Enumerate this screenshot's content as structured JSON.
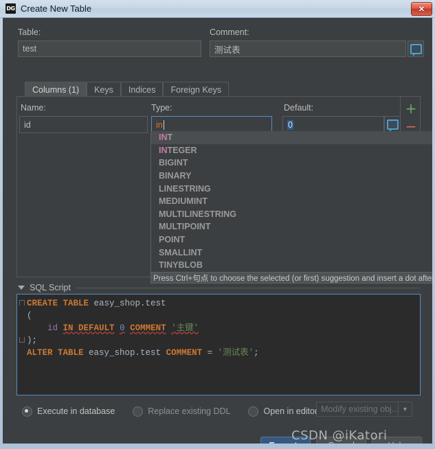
{
  "window": {
    "title": "Create New Table",
    "app_icon": "datagrip-icon",
    "app_icon_text": "DG",
    "close_label": "✕",
    "titlebar_bg": "#c6d6e6"
  },
  "form": {
    "table_label": "Table:",
    "table_label_mnemonic": "b",
    "table_value": "test",
    "comment_label": "Comment:",
    "comment_label_mnemonic": "C",
    "comment_value": "测试表",
    "comment_button_icon": "comment-bubble-icon"
  },
  "tabs": [
    {
      "label": "Columns (1)",
      "active": true
    },
    {
      "label": "Keys",
      "active": false
    },
    {
      "label": "Indices",
      "active": false
    },
    {
      "label": "Foreign Keys",
      "active": false
    }
  ],
  "columns_panel": {
    "name_label": "Name:",
    "type_label": "Type:",
    "default_label": "Default:",
    "row": {
      "name": "id",
      "type": "in",
      "default": "0",
      "comment_button_icon": "comment-bubble-icon"
    },
    "add_label": "+",
    "remove_label": "−",
    "add_color": "#69ac67",
    "remove_color": "#d06b5c"
  },
  "autocomplete": {
    "prefix": "IN",
    "items": [
      {
        "text": "INT",
        "match": "IN",
        "selected": true
      },
      {
        "text": "INTEGER",
        "match": "IN",
        "selected": false
      },
      {
        "text": "BIGINT",
        "match": "",
        "selected": false
      },
      {
        "text": "BINARY",
        "match": "",
        "selected": false
      },
      {
        "text": "LINESTRING",
        "match": "",
        "selected": false
      },
      {
        "text": "MEDIUMINT",
        "match": "",
        "selected": false
      },
      {
        "text": "MULTILINESTRING",
        "match": "",
        "selected": false
      },
      {
        "text": "MULTIPOINT",
        "match": "",
        "selected": false
      },
      {
        "text": "POINT",
        "match": "",
        "selected": false
      },
      {
        "text": "SMALLINT",
        "match": "",
        "selected": false
      },
      {
        "text": "TINYBLOB",
        "match": "",
        "selected": false
      }
    ],
    "hint": "Press Ctrl+句点 to choose the selected (or first) suggestion and insert a dot afterwards"
  },
  "sql_section": {
    "title": "SQL Script",
    "title_mnemonic": "S",
    "expanded": true,
    "lines": [
      [
        {
          "t": "CREATE TABLE",
          "c": "kw"
        },
        {
          "t": " ",
          "c": "plain"
        },
        {
          "t": "easy_shop.test",
          "c": "ident"
        }
      ],
      [
        {
          "t": "(",
          "c": "plain"
        }
      ],
      [
        {
          "t": "    ",
          "c": "plain"
        },
        {
          "t": "id",
          "c": "field"
        },
        {
          "t": " ",
          "c": "plain"
        },
        {
          "t": "IN DEFAULT",
          "c": "kw err"
        },
        {
          "t": " ",
          "c": "plain"
        },
        {
          "t": "0",
          "c": "num err"
        },
        {
          "t": " ",
          "c": "plain"
        },
        {
          "t": "COMMENT",
          "c": "kw err"
        },
        {
          "t": " ",
          "c": "plain"
        },
        {
          "t": "'主键'",
          "c": "str err"
        }
      ],
      [
        {
          "t": ");",
          "c": "plain"
        }
      ],
      [
        {
          "t": "ALTER TABLE",
          "c": "kw"
        },
        {
          "t": " ",
          "c": "plain"
        },
        {
          "t": "easy_shop.test",
          "c": "ident"
        },
        {
          "t": " ",
          "c": "plain"
        },
        {
          "t": "COMMENT",
          "c": "kw"
        },
        {
          "t": " = ",
          "c": "plain"
        },
        {
          "t": "'测试表'",
          "c": "str"
        },
        {
          "t": ";",
          "c": "plain"
        }
      ]
    ]
  },
  "options": {
    "radios": [
      {
        "label": "Execute in database",
        "selected": true,
        "enabled": true
      },
      {
        "label": "Replace existing DDL",
        "selected": false,
        "enabled": false
      },
      {
        "label": "Open in editor:",
        "selected": false,
        "enabled": true
      }
    ],
    "combo_value": "Modify existing obj...",
    "combo_arrow": "▼",
    "combo_enabled": false
  },
  "buttons": {
    "execute": "Execute",
    "cancel": "Cancel",
    "help": "Help",
    "execute_bg": "#365880"
  },
  "watermark": "CSDN @iKatori"
}
